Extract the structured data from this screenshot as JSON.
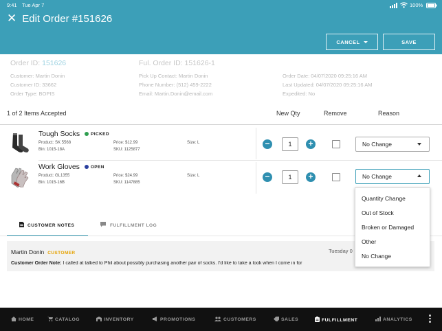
{
  "statusbar": {
    "time": "9:41",
    "date": "Tue Apr 7",
    "battery": "100%"
  },
  "header": {
    "title": "Edit Order #151626",
    "cancel_label": "CANCEL",
    "save_label": "SAVE"
  },
  "order_info": {
    "order_id_label": "Order ID:",
    "order_id_value": "151626",
    "ful_order_id": "Ful. Order ID: 151626-1",
    "customer": "Customer: Martin Donin",
    "customer_id": "Customer ID: 33662",
    "order_type": "Order Type: BOPIS",
    "pickup_contact": "Pick Up Contact: Martin Donin",
    "phone": "Phone Number: (512) 459-2222",
    "email": "Email: Martin.Donin@email.com",
    "order_date": "Order Date: 04/07/2020 09:25:16 AM",
    "last_updated": "Last Updated: 04/07/2020 09:25:16 AM",
    "expedited": "Expedited: No"
  },
  "items_header": {
    "accepted": "1 of 2 Items Accepted",
    "new_qty": "New Qty",
    "remove": "Remove",
    "reason": "Reason"
  },
  "items": [
    {
      "name": "Tough Socks",
      "status": "PICKED",
      "status_color": "#2e9e4f",
      "product": "Product: SK 5568",
      "bin": "Bin: 1015-18A",
      "price": "Price: $12.99",
      "sku": "SKU: 1125877",
      "size": "Size: L",
      "qty": "1",
      "reason": "No Change"
    },
    {
      "name": "Work Gloves",
      "status": "OPEN",
      "status_color": "#2a3f9e",
      "product": "Product: GL1355",
      "bin": "Bin: 1015-16B",
      "price": "Price: $24.99",
      "sku": "SKU: 1147885",
      "size": "Size: L",
      "qty": "1",
      "reason": "No Change"
    }
  ],
  "reason_menu": [
    "Quantity Change",
    "Out of Stock",
    "Broken or Damaged",
    "Other",
    "No Change"
  ],
  "tabs": {
    "notes": "CUSTOMER NOTES",
    "log": "FULFILLMENT LOG"
  },
  "note": {
    "author": "Martin Donin",
    "role": "CUSTOMER",
    "date": "Tuesday 0",
    "label": "Customer Order Note:",
    "text": " I called at talked to Phil about possibly purchasing another pair of socks. I'd like to take a look when I come in for"
  },
  "nav": {
    "home": "HOME",
    "catalog": "CATALOG",
    "inventory": "INVENTORY",
    "promotions": "PROMOTIONS",
    "customers": "CUSTOMERS",
    "sales": "SALES",
    "fulfillment": "FULFILLMENT",
    "analytics": "ANALYTICS"
  },
  "colors": {
    "header": "#3c9fb8",
    "accent": "#2f8fb0",
    "nav_bg": "#111111"
  }
}
